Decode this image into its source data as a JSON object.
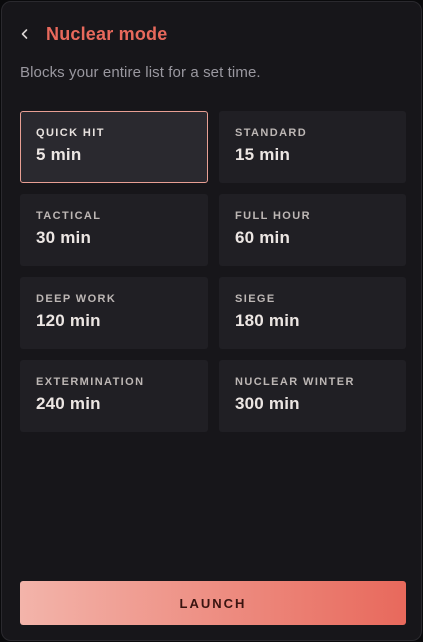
{
  "header": {
    "back_icon": "chevron-left-icon",
    "title": "Nuclear mode"
  },
  "subtitle": "Blocks your entire list for a set time.",
  "options": [
    {
      "label": "QUICK HIT",
      "value": "5 min",
      "selected": true
    },
    {
      "label": "STANDARD",
      "value": "15 min",
      "selected": false
    },
    {
      "label": "TACTICAL",
      "value": "30 min",
      "selected": false
    },
    {
      "label": "FULL HOUR",
      "value": "60 min",
      "selected": false
    },
    {
      "label": "DEEP WORK",
      "value": "120 min",
      "selected": false
    },
    {
      "label": "SIEGE",
      "value": "180 min",
      "selected": false
    },
    {
      "label": "EXTERMINATION",
      "value": "240 min",
      "selected": false
    },
    {
      "label": "NUCLEAR WINTER",
      "value": "300 min",
      "selected": false
    }
  ],
  "launch": {
    "label": "LAUNCH"
  },
  "colors": {
    "accent": "#e8695c",
    "launch_gradient_start": "#f3b4aa",
    "launch_gradient_end": "#e8695c",
    "selected_border": "#e89f94"
  }
}
